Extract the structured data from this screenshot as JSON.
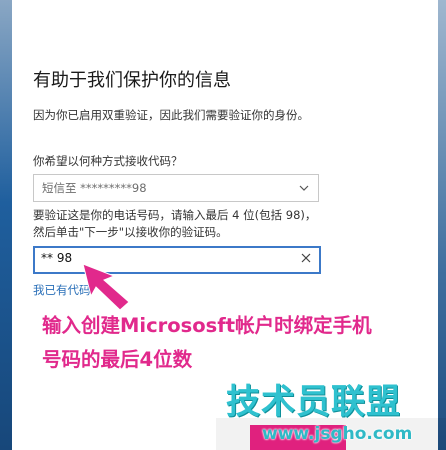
{
  "dialog": {
    "title": "有助于我们保护你的信息",
    "description": "因为你已启用双重验证，因此我们需要验证你的身份。",
    "method_label": "你希望以何种方式接收代码？",
    "method_selected": "短信至 *********98",
    "instructions_line1": "要验证这是你的电话号码，请输入最后 4 位(包括 98)，",
    "instructions_line2": "然后单击\"下一步\"以接收你的验证码。",
    "code_value": "** 98",
    "have_code_link": "我已有代码"
  },
  "annotation": {
    "line1": "输入创建Micrososft帐户时绑定手机",
    "line2": "号码的最后4位数",
    "color": "#e1298c"
  },
  "watermark": {
    "text_cn": "技术员联盟",
    "url": "www.jsgho.com",
    "color": "#2fc1cf"
  },
  "colors": {
    "focus_border": "#3c79c8",
    "link": "#2a6fb8",
    "button_accent": "#e0217e"
  },
  "icons": {
    "dropdown": "chevron-down-icon",
    "clear": "close-icon"
  }
}
